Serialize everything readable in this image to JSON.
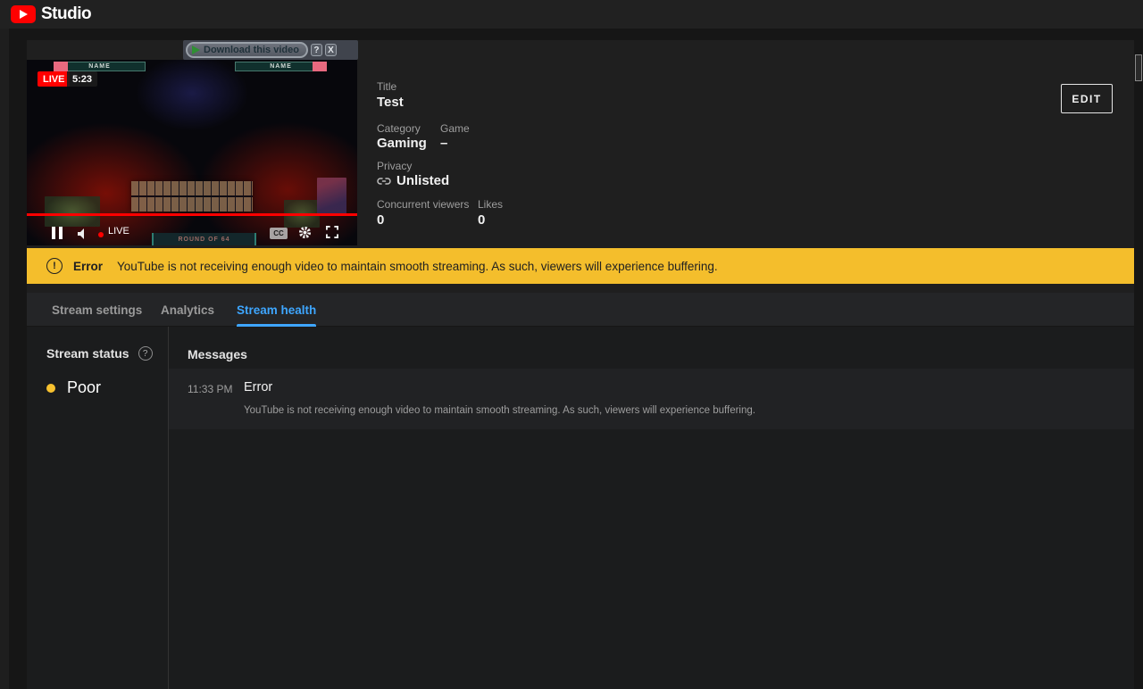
{
  "topbar": {
    "brand": "Studio"
  },
  "download_overlay": {
    "label": "Download this video",
    "help": "?",
    "close": "X"
  },
  "video": {
    "live_badge": "LIVE",
    "elapsed_time": "5:23",
    "name_left": "NAME",
    "name_right": "NAME",
    "round_label": "ROUND OF 64",
    "live_indicator": "LIVE",
    "cc_label": "CC"
  },
  "details": {
    "title_label": "Title",
    "title_value": "Test",
    "category_label": "Category",
    "category_value": "Gaming",
    "game_label": "Game",
    "game_value": "–",
    "privacy_label": "Privacy",
    "privacy_value": "Unlisted",
    "viewers_label": "Concurrent viewers",
    "viewers_value": "0",
    "likes_label": "Likes",
    "likes_value": "0",
    "edit_label": "EDIT"
  },
  "banner": {
    "icon": "!",
    "title": "Error",
    "message": "YouTube is not receiving enough video to maintain smooth streaming. As such, viewers will experience buffering."
  },
  "tabs": [
    {
      "label": "Stream settings",
      "active": false
    },
    {
      "label": "Analytics",
      "active": false
    },
    {
      "label": "Stream health",
      "active": true
    }
  ],
  "health": {
    "status_label": "Stream status",
    "status_help": "?",
    "status_value": "Poor",
    "messages_label": "Messages",
    "messages": [
      {
        "time": "11:33 PM",
        "title": "Error",
        "text": "YouTube is not receiving enough video to maintain smooth streaming. As such, viewers will experience buffering."
      }
    ]
  },
  "colors": {
    "accent_blue": "#3EA6FF",
    "warning_yellow": "#F4BE2C",
    "live_red": "#FF0000",
    "status_poor_dot": "#F7C12F"
  }
}
